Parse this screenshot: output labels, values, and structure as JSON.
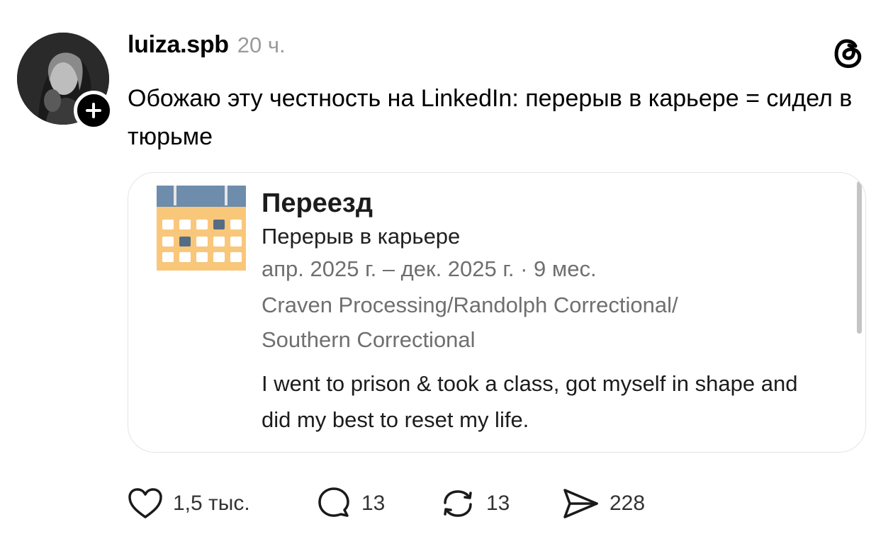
{
  "post": {
    "username": "luiza.spb",
    "timestamp": "20 ч.",
    "text": "Обожаю эту честность на LinkedIn: перерыв в карьере = сидел в тюрьме"
  },
  "card": {
    "title": "Переезд",
    "subtitle": "Перерыв в карьере",
    "dates": "апр. 2025 г. – дек. 2025 г. · 9 мес.",
    "location_line1": "Craven Processing/Randolph Correctional/",
    "location_line2": "Southern Correctional",
    "description": "I went to prison & took a class, got myself in shape and did my best to reset my life."
  },
  "actions": {
    "likes": "1,5 тыс.",
    "comments": "13",
    "reposts": "13",
    "shares": "228"
  },
  "icons": {
    "follow": "plus-icon",
    "brand": "threads-logo-icon",
    "calendar": "calendar-icon",
    "like": "heart-icon",
    "comment": "comment-bubble-icon",
    "repost": "repost-icon",
    "share": "send-icon"
  },
  "colors": {
    "calendar_top": "#6E8CAB",
    "calendar_body": "#F9C77A",
    "calendar_marker": "#566C84",
    "muted_text": "#6f6f6f"
  }
}
